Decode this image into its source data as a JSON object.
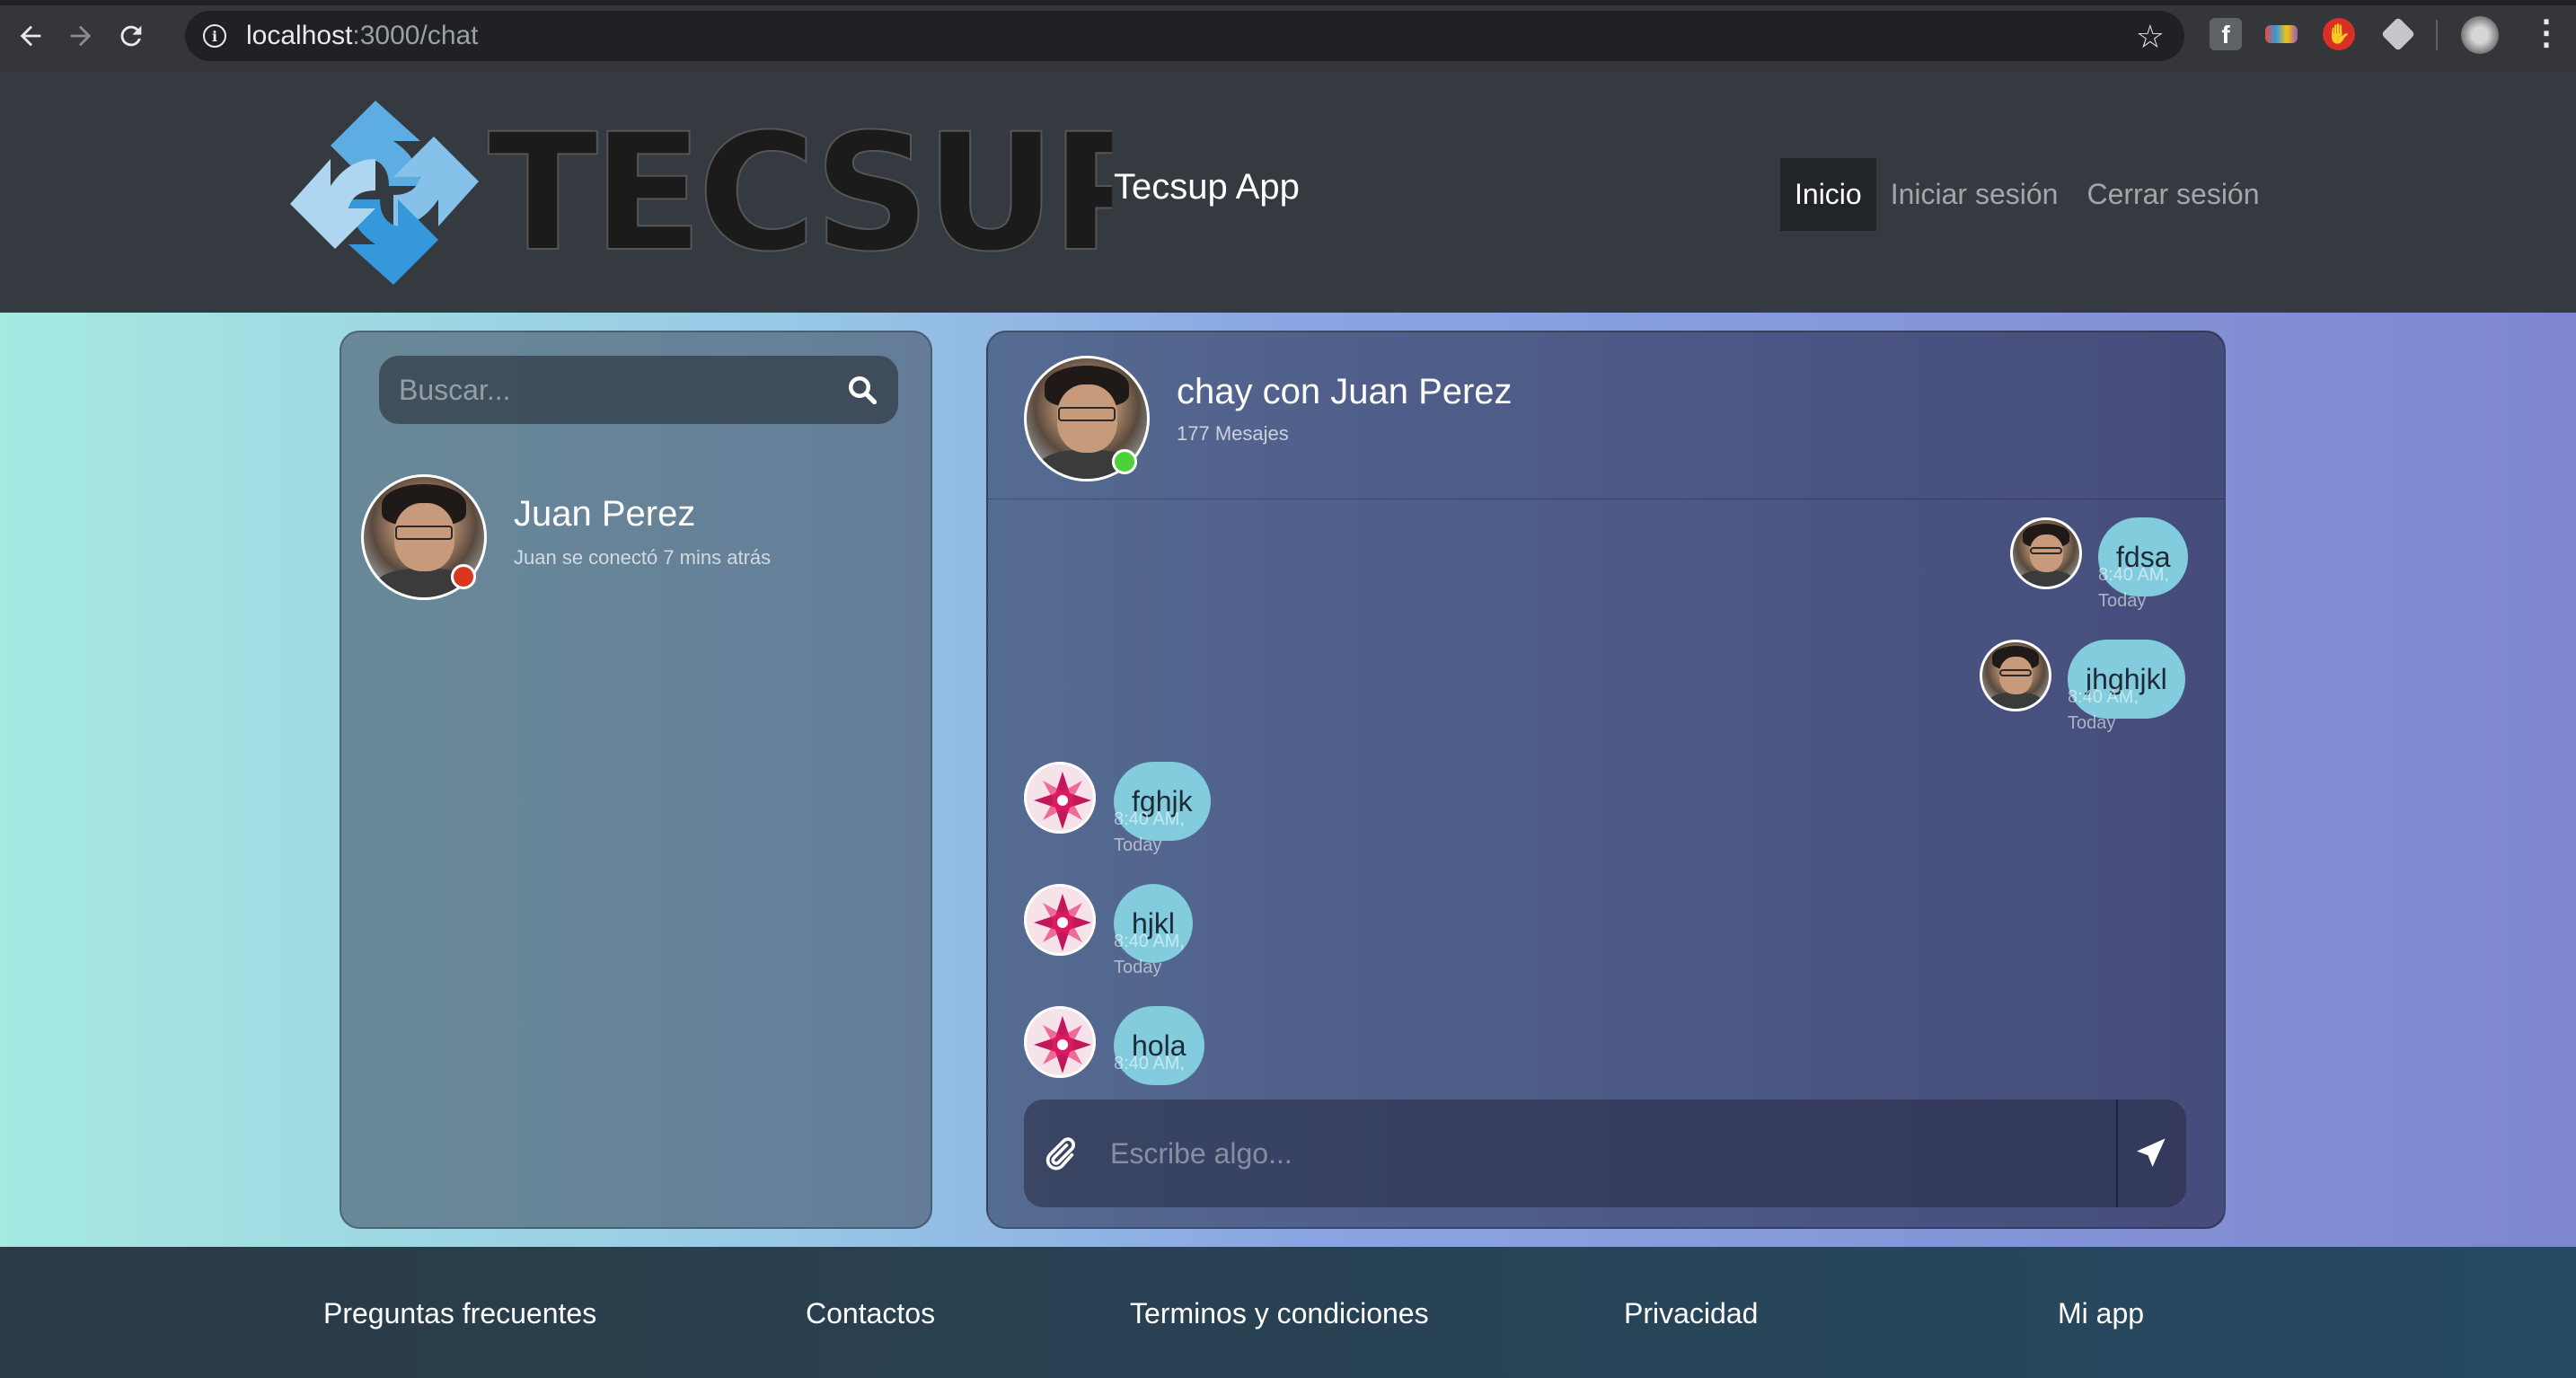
{
  "browser": {
    "url_host": "localhost",
    "url_path": ":3000/chat",
    "extensions": [
      "facebook-extension-icon",
      "flag-extension-icon",
      "adblock-extension-icon",
      "cube-extension-icon",
      "profile-avatar-icon"
    ]
  },
  "header": {
    "logo_text": "TECSUP",
    "brand": "Tecsup App",
    "nav": [
      {
        "label": "Inicio",
        "active": true
      },
      {
        "label": "Iniciar sesión",
        "active": false
      },
      {
        "label": "Cerrar sesión",
        "active": false
      }
    ]
  },
  "contacts": {
    "search_placeholder": "Buscar...",
    "items": [
      {
        "name": "Juan Perez",
        "status": "Juan se conectó 7 mins atrás",
        "online": false
      }
    ]
  },
  "chat": {
    "title": "chay con Juan Perez",
    "count": "177 Mesajes",
    "messages": [
      {
        "text": "fdsa",
        "time1": "8:40 AM,",
        "time2": "Today",
        "side": "right"
      },
      {
        "text": "jhghjkl",
        "time1": "8:40 AM,",
        "time2": "Today",
        "side": "right"
      },
      {
        "text": "fghjk",
        "time1": "8:40 AM,",
        "time2": "Today",
        "side": "left"
      },
      {
        "text": "hjkl",
        "time1": "8:40 AM,",
        "time2": "Today",
        "side": "left"
      },
      {
        "text": "hola",
        "time1": "8:40 AM,",
        "time2": "",
        "side": "left"
      }
    ],
    "input_placeholder": "Escribe algo..."
  },
  "footer": {
    "links": [
      "Preguntas frecuentes",
      "Contactos",
      "Terminos y condiciones",
      "Privacidad",
      "Mi app"
    ]
  },
  "colors": {
    "header_bg": "#343a40",
    "bubble": "#82ccdd",
    "status_offline": "#d9381e",
    "status_online": "#4cd137"
  }
}
